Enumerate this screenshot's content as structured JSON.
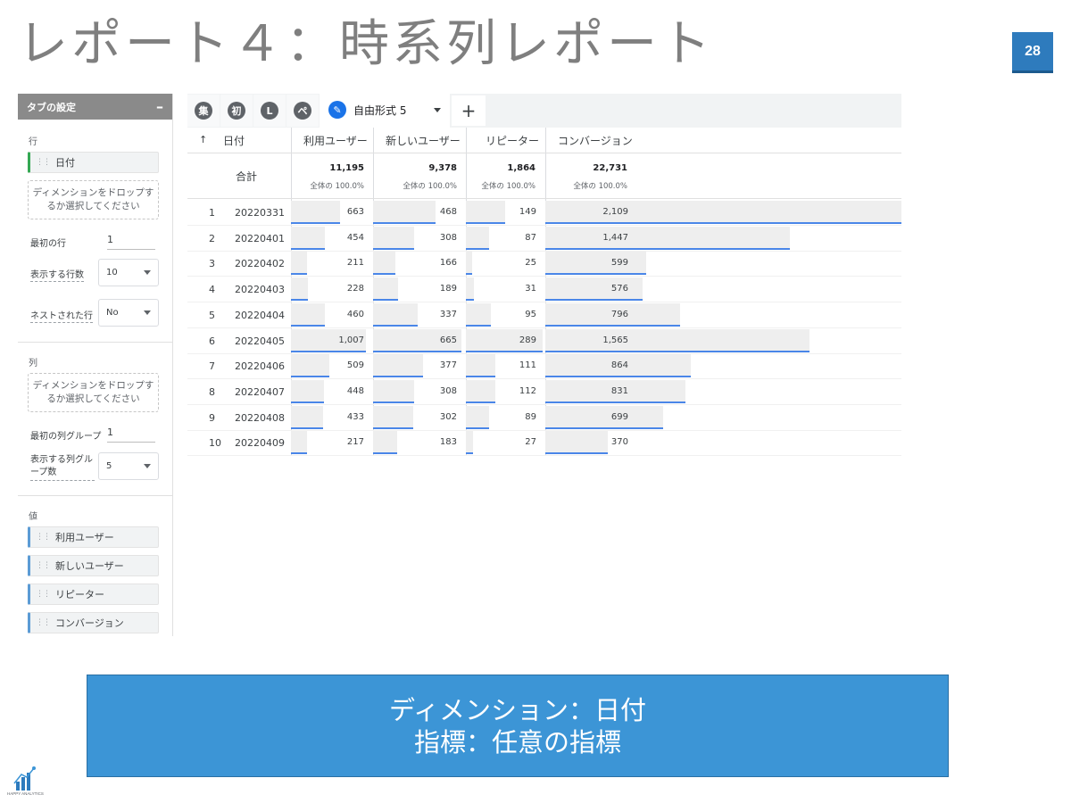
{
  "slide": {
    "title": "レポート４：時系列レポート",
    "page_number": "28",
    "callout_line1": "ディメンション：日付",
    "callout_line2": "指標：任意の指標",
    "logo_text": "HAPPY ANALYTICS"
  },
  "panel": {
    "header": "タブの設定",
    "collapse": "–",
    "rows_label": "行",
    "row_dimension": "日付",
    "drop_zone_text": "ディメンションをドロップするか選択してください",
    "first_row_label": "最初の行",
    "first_row_value": "1",
    "rows_to_show_label": "表示する行数",
    "rows_to_show_value": "10",
    "nested_rows_label": "ネストされた行",
    "nested_rows_value": "No",
    "columns_label": "列",
    "first_col_group_label": "最初の列グループ",
    "first_col_group_value": "1",
    "col_groups_label": "表示する列グループ数",
    "col_groups_value": "5",
    "values_label": "値",
    "values": [
      "利用ユーザー",
      "新しいユーザー",
      "リピーター",
      "コンバージョン"
    ]
  },
  "tabs": {
    "icons": [
      "集",
      "初",
      "L",
      "ペ"
    ],
    "active_label": "自由形式 5",
    "add": "+"
  },
  "table": {
    "sort_arrow": "↑",
    "date_header": "日付",
    "metric_headers": [
      "利用ユーザー",
      "新しいユーザー",
      "リピーター",
      "コンバージョン"
    ],
    "total_label": "合計",
    "totals": [
      "11,195",
      "9,378",
      "1,864",
      "22,731"
    ],
    "total_pcts": [
      "全体の 100.0%",
      "全体の 100.0%",
      "全体の 100.0%",
      "全体の 100.0%"
    ],
    "rows": [
      {
        "idx": "1",
        "date": "20220331",
        "vals": [
          "663",
          "468",
          "149",
          "2,109"
        ],
        "nums": [
          663,
          468,
          149,
          2109
        ]
      },
      {
        "idx": "2",
        "date": "20220401",
        "vals": [
          "454",
          "308",
          "87",
          "1,447"
        ],
        "nums": [
          454,
          308,
          87,
          1447
        ]
      },
      {
        "idx": "3",
        "date": "20220402",
        "vals": [
          "211",
          "166",
          "25",
          "599"
        ],
        "nums": [
          211,
          166,
          25,
          599
        ]
      },
      {
        "idx": "4",
        "date": "20220403",
        "vals": [
          "228",
          "189",
          "31",
          "576"
        ],
        "nums": [
          228,
          189,
          31,
          576
        ]
      },
      {
        "idx": "5",
        "date": "20220404",
        "vals": [
          "460",
          "337",
          "95",
          "796"
        ],
        "nums": [
          460,
          337,
          95,
          796
        ]
      },
      {
        "idx": "6",
        "date": "20220405",
        "vals": [
          "1,007",
          "665",
          "289",
          "1,565"
        ],
        "nums": [
          1007,
          665,
          289,
          1565
        ]
      },
      {
        "idx": "7",
        "date": "20220406",
        "vals": [
          "509",
          "377",
          "111",
          "864"
        ],
        "nums": [
          509,
          377,
          111,
          864
        ]
      },
      {
        "idx": "8",
        "date": "20220407",
        "vals": [
          "448",
          "308",
          "112",
          "831"
        ],
        "nums": [
          448,
          308,
          112,
          831
        ]
      },
      {
        "idx": "9",
        "date": "20220408",
        "vals": [
          "433",
          "302",
          "89",
          "699"
        ],
        "nums": [
          433,
          302,
          89,
          699
        ]
      },
      {
        "idx": "10",
        "date": "20220409",
        "vals": [
          "217",
          "183",
          "27",
          "370"
        ],
        "nums": [
          217,
          183,
          27,
          370
        ]
      }
    ]
  },
  "colors": {
    "accent": "#1a73e8",
    "bar_line": "#4a86e8",
    "callout_bg": "#3c95d6",
    "page_badge": "#2e7bbd"
  }
}
